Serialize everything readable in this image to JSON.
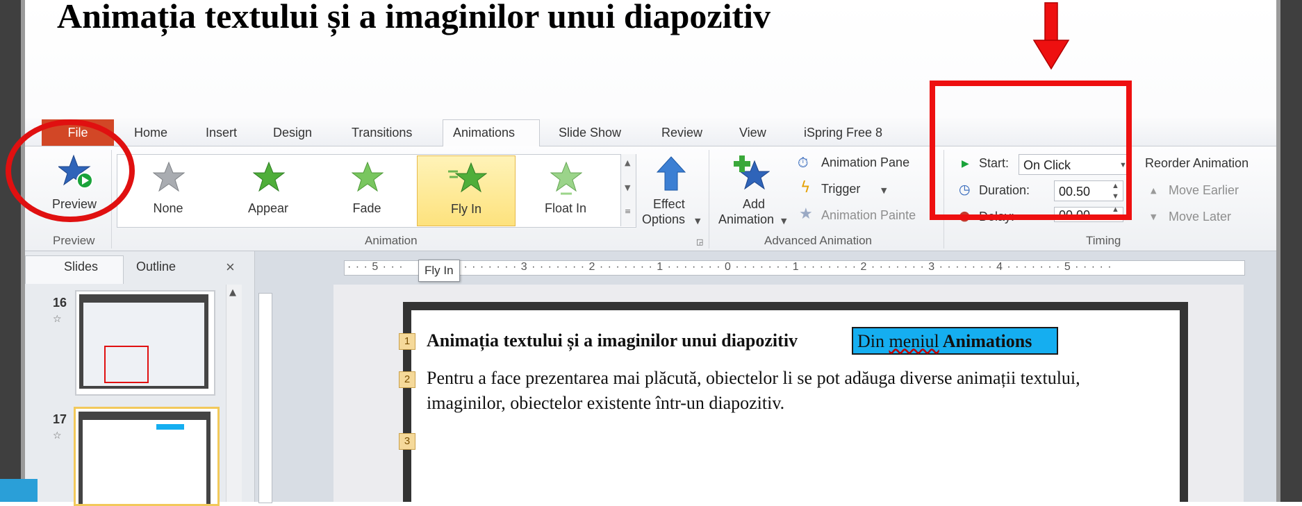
{
  "slide_title": "Animația textului și a imaginilor unui diapozitiv",
  "colors": {
    "accent_red": "#ee1010",
    "file_tab": "#d24726",
    "highlight_blue": "#15aef0"
  },
  "ribbon": {
    "file_tab": "File",
    "tabs": [
      "Home",
      "Insert",
      "Design",
      "Transitions",
      "Animations",
      "Slide Show",
      "Review",
      "View",
      "iSpring Free 8"
    ],
    "active_tab": "Animations",
    "preview_button": "Preview",
    "preview_group": "Preview",
    "animation_group": "Animation",
    "animations": [
      "None",
      "Appear",
      "Fade",
      "Fly In",
      "Float In"
    ],
    "selected_animation": "Fly In",
    "effect_options": [
      "Effect",
      "Options"
    ],
    "add_animation": [
      "Add",
      "Animation"
    ],
    "advanced_group": "Advanced Animation",
    "animation_pane": "Animation Pane",
    "trigger": "Trigger",
    "animation_painter": "Animation Painte",
    "timing_group": "Timing",
    "start_label": "Start:",
    "start_value": "On Click",
    "duration_label": "Duration:",
    "duration_value": "00.50",
    "delay_label": "Delay:",
    "delay_value": "00.00",
    "reorder_label": "Reorder Animation",
    "move_earlier": "Move Earlier",
    "move_later": "Move Later"
  },
  "pane": {
    "tabs": [
      "Slides",
      "Outline"
    ],
    "close": "×",
    "slides": [
      {
        "number": "16"
      },
      {
        "number": "17"
      }
    ]
  },
  "ruler": {
    "left_marks": "· · · 5 · · ·",
    "right_marks": "4 · · · · · · · 3 · · · · · · · 2 · · · · · · · 1 · · · · · · · 0 · · · · · · · 1 · · · · · · · 2 · · · · · · · 3 · · · · · · · 4 · · · · · · · 5 · · · · ·",
    "tooltip": "Fly In"
  },
  "slide": {
    "items": [
      {
        "badge": "1",
        "text": "Animația textului și a imaginilor unui diapozitiv"
      },
      {
        "badge": "2",
        "line1": "Pentru a  face prezentarea mai plăcută, obiectelor li se pot adăuga  diverse animații textului,",
        "line2": "imaginilor, obiectelor existente într-un diapozitiv."
      },
      {
        "badge": "3"
      }
    ],
    "highlight_prefix": "Din ",
    "highlight_word": "meniul",
    "highlight_suffix": " Animations"
  }
}
